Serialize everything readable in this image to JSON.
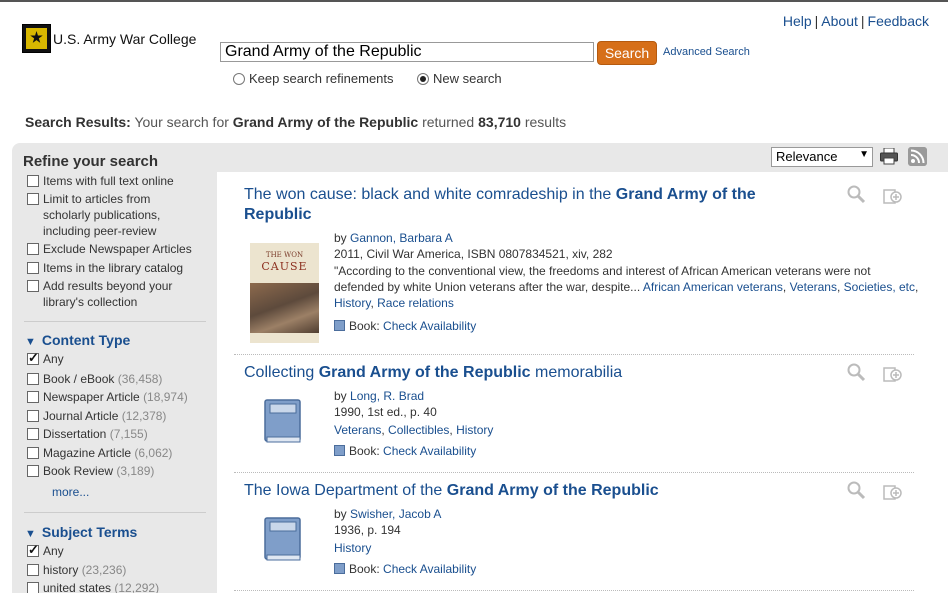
{
  "header": {
    "logo_text": "U.S. Army War College",
    "search_value": "Grand Army of the Republic",
    "search_button": "Search",
    "advanced_search": "Advanced Search",
    "radio_keep": "Keep search refinements",
    "radio_new": "New search",
    "radio_selected": "New search",
    "top_links": [
      "Help",
      "About",
      "Feedback"
    ]
  },
  "summary": {
    "label": "Search Results:",
    "prefix": "Your search for",
    "query": "Grand Army of the Republic",
    "middle": "returned",
    "count": "83,710",
    "suffix": "results"
  },
  "refine": {
    "title": "Refine your search",
    "options": [
      {
        "label": "Items with full text online",
        "checked": false
      },
      {
        "label": "Limit to articles from scholarly publications, including peer-review",
        "checked": false
      },
      {
        "label": "Exclude Newspaper Articles",
        "checked": false
      },
      {
        "label": "Items in the library catalog",
        "checked": false
      },
      {
        "label": "Add results beyond your library's collection",
        "checked": false
      }
    ],
    "content_type": {
      "title": "Content Type",
      "items": [
        {
          "label": "Any",
          "count": "",
          "checked": true
        },
        {
          "label": "Book / eBook",
          "count": "(36,458)",
          "checked": false
        },
        {
          "label": "Newspaper Article",
          "count": "(18,974)",
          "checked": false
        },
        {
          "label": "Journal Article",
          "count": "(12,378)",
          "checked": false
        },
        {
          "label": "Dissertation",
          "count": "(7,155)",
          "checked": false
        },
        {
          "label": "Magazine Article",
          "count": "(6,062)",
          "checked": false
        },
        {
          "label": "Book Review",
          "count": "(3,189)",
          "checked": false
        }
      ],
      "more": "more..."
    },
    "subject_terms": {
      "title": "Subject Terms",
      "items": [
        {
          "label": "Any",
          "count": "",
          "checked": true
        },
        {
          "label": "history",
          "count": "(23,236)",
          "checked": false
        },
        {
          "label": "united states",
          "count": "(12,292)",
          "checked": false
        }
      ]
    }
  },
  "sort": {
    "selected": "Relevance"
  },
  "results": [
    {
      "title_pre": "The won cause: black and white comradeship in the ",
      "title_bold": "Grand Army of the Republic",
      "title_post": "",
      "author_prefix": "by",
      "author": "Gannon, Barbara A",
      "pub": "2011, Civil War America, ISBN 0807834521, xiv, 282",
      "snippet": "\"According to the conventional view, the freedoms and interest of African American veterans were not defended by white Union veterans after the war, despite...",
      "subjects": [
        "African American veterans",
        "Veterans",
        "Societies, etc",
        "History",
        "Race relations"
      ],
      "format": "Book:",
      "availability": "Check Availability",
      "cover_small": "THE WON",
      "cover_big": "CAUSE"
    },
    {
      "title_pre": "Collecting ",
      "title_bold": "Grand Army of the Republic",
      "title_post": " memorabilia",
      "author_prefix": "by",
      "author": "Long, R. Brad",
      "pub": "1990, 1st ed., p. 40",
      "subjects": [
        "Veterans",
        "Collectibles",
        "History"
      ],
      "format": "Book:",
      "availability": "Check Availability"
    },
    {
      "title_pre": "The Iowa Department of the ",
      "title_bold": "Grand Army of the Republic",
      "title_post": "",
      "author_prefix": "by",
      "author": "Swisher, Jacob A",
      "pub": "1936, p. 194",
      "subjects": [
        "History"
      ],
      "format": "Book:",
      "availability": "Check Availability"
    }
  ],
  "colors": {
    "link": "#1a4f8f",
    "search_button": "#d66f19",
    "panel_bg": "#e8e8e8"
  }
}
